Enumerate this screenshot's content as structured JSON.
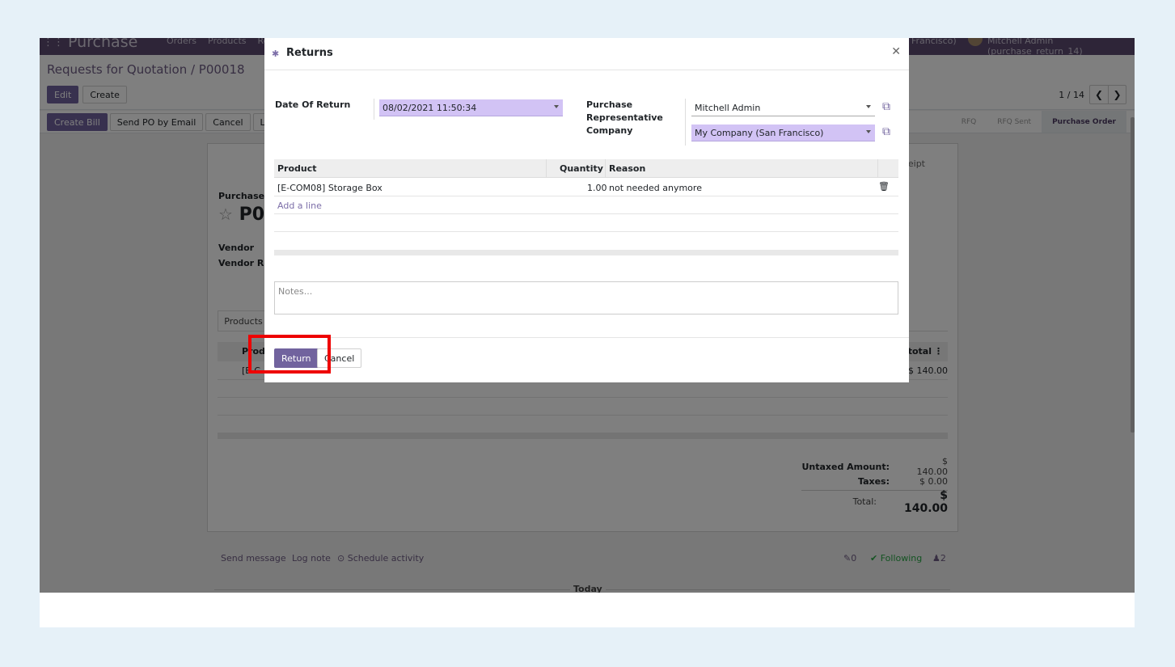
{
  "navbar": {
    "apps_icon": "⋮⋮",
    "brand": "Purchase",
    "menu": [
      "Orders",
      "Products",
      "Re"
    ],
    "company": "Francisco)",
    "user": "Mitchell Admin (purchase_return_14)"
  },
  "control_panel": {
    "breadcrumb": "Requests for Quotation / P00018",
    "edit": "Edit",
    "create": "Create",
    "pager": "1 / 14"
  },
  "statusbar": {
    "buttons": [
      "Create Bill",
      "Send PO by Email",
      "Cancel",
      "Lock"
    ],
    "stages": [
      "RFQ",
      "RFQ Sent",
      "Purchase Order"
    ]
  },
  "sheet": {
    "receipt_partial": "eipt",
    "label_purchase_order": "Purchase O",
    "title_partial": "P0",
    "vendor": "Vendor",
    "vendor_ref": "Vendor Ref",
    "tab_products": "Products",
    "col_product": "Prod",
    "col_total": "total",
    "row_product": "[E-C",
    "row_total": "$ 140.00",
    "untaxed_label": "Untaxed Amount:",
    "untaxed_value": "$ 140.00",
    "taxes_label": "Taxes:",
    "taxes_value": "$ 0.00",
    "total_label": "Total:",
    "total_value": "$ 140.00"
  },
  "chatter": {
    "send_message": "Send message",
    "log_note": "Log note",
    "schedule_activity": "Schedule activity",
    "attachments": "0",
    "following": "Following",
    "followers": "2",
    "today": "Today"
  },
  "modal": {
    "title": "Returns",
    "date_label": "Date Of Return",
    "date_value": "08/02/2021 11:50:34",
    "rep_label_lines": [
      "Purchase",
      "Representative",
      "Company"
    ],
    "rep_value": "Mitchell Admin",
    "company_value": "My Company (San Francisco)",
    "table": {
      "headers": [
        "Product",
        "Quantity",
        "Reason"
      ],
      "rows": [
        {
          "product": "[E-COM08] Storage Box",
          "quantity": "1.00",
          "reason": "not needed anymore"
        }
      ],
      "add_line": "Add a line"
    },
    "notes_placeholder": "Notes...",
    "return_button": "Return",
    "cancel_button": "Cancel"
  },
  "colors": {
    "brand": "#5c4b71",
    "primary": "#71639e",
    "required_field": "#d2c3f5",
    "highlight": "#ee0000"
  }
}
